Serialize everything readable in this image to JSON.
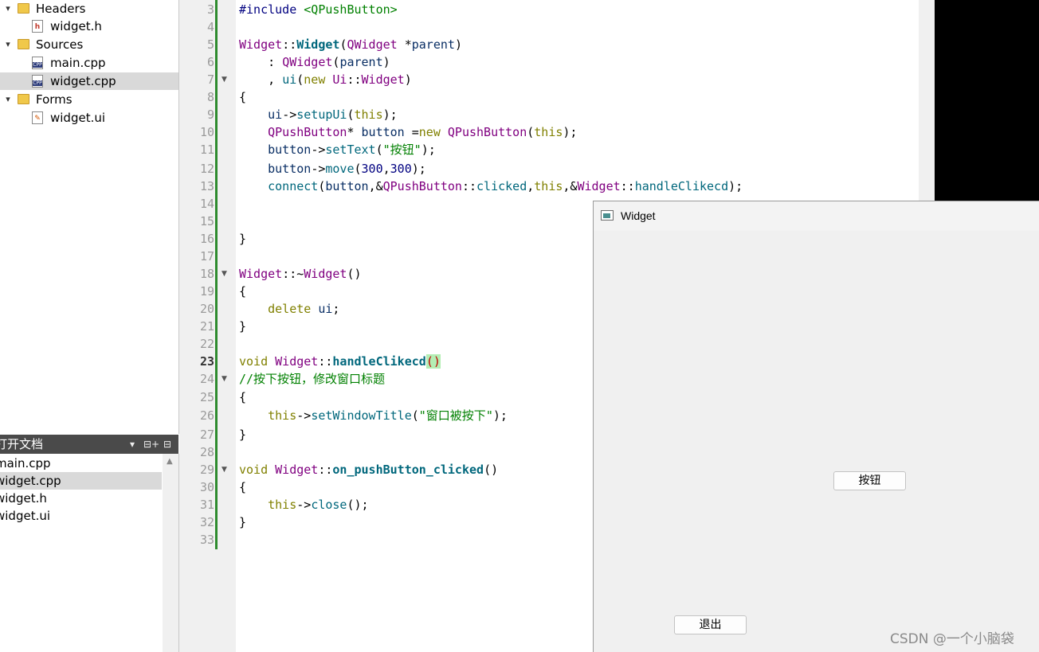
{
  "project_tree": [
    {
      "label": "Headers",
      "kind": "folder",
      "badge": "h",
      "expanded": true
    },
    {
      "label": "widget.h",
      "kind": "header"
    },
    {
      "label": "Sources",
      "kind": "folder",
      "badge": "c++",
      "expanded": true
    },
    {
      "label": "main.cpp",
      "kind": "cpp"
    },
    {
      "label": "widget.cpp",
      "kind": "cpp",
      "selected": true
    },
    {
      "label": "Forms",
      "kind": "folder",
      "expanded": true
    },
    {
      "label": "widget.ui",
      "kind": "ui"
    }
  ],
  "icons": {
    "expanded": "▾",
    "fold": "▼",
    "split": "⊟+",
    "close": "⊟",
    "scroll_up": "▲",
    "file_h": "h",
    "file_cpp": "CPP",
    "file_ui": "✎"
  },
  "open_docs": {
    "title": "打开文档",
    "items": [
      "main.cpp",
      "widget.cpp",
      "widget.h",
      "widget.ui"
    ],
    "selected": "widget.cpp"
  },
  "editor": {
    "current_line": "23",
    "line_numbers": [
      "3",
      "4",
      "5",
      "6",
      "7",
      "8",
      "9",
      "10",
      "11",
      "12",
      "13",
      "14",
      "15",
      "16",
      "17",
      "18",
      "19",
      "20",
      "21",
      "22",
      "23",
      "24",
      "25",
      "26",
      "27",
      "28",
      "29",
      "30",
      "31",
      "32",
      "33"
    ],
    "lines": [
      "#include <QPushButton>",
      "",
      "Widget::Widget(QWidget *parent)",
      "    : QWidget(parent)",
      "    , ui(new Ui::Widget)",
      "{",
      "    ui->setupUi(this);",
      "    QPushButton* button =new QPushButton(this);",
      "    button->setText(\"按钮\");",
      "    button->move(300,300);",
      "    connect(button,&QPushButton::clicked,this,&Widget::handleClikecd);",
      "",
      "",
      "}",
      "",
      "Widget::~Widget()",
      "{",
      "    delete ui;",
      "}",
      "",
      "void Widget::handleClikecd()",
      "//按下按钮，修改窗口标题",
      "{",
      "    this->setWindowTitle(\"窗口被按下\");",
      "}",
      "",
      "void Widget::on_pushButton_clicked()",
      "{",
      "    this->close();",
      "}",
      ""
    ]
  },
  "widget_window": {
    "title": "Widget",
    "button_press": "按钮",
    "button_quit": "退出"
  },
  "watermark": "CSDN @一个小脑袋"
}
